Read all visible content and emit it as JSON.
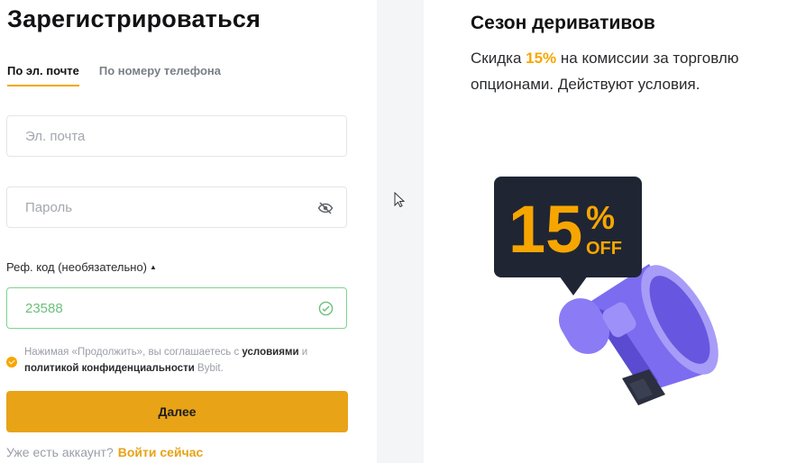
{
  "form": {
    "title": "Зарегистрироваться",
    "tabs": [
      {
        "label": "По эл. почте",
        "active": true
      },
      {
        "label": "По номеру телефона",
        "active": false
      }
    ],
    "email": {
      "placeholder": "Эл. почта",
      "value": ""
    },
    "password": {
      "placeholder": "Пароль",
      "value": ""
    },
    "ref": {
      "label": "Реф. код (необязательно)",
      "arrow": "▲",
      "value": "23588"
    },
    "consent": {
      "prefix": "Нажимая «Продолжить», вы соглашаетесь с",
      "terms_link": "условиями",
      "and": "и",
      "privacy_link": "политикой конфиденциальности",
      "suffix": "Bybit."
    },
    "submit_label": "Далее",
    "login_prompt": "Уже есть аккаунт?",
    "login_link": "Войти сейчас"
  },
  "promo": {
    "title": "Сезон деривативов",
    "text_before": "Скидка",
    "highlight": "15%",
    "text_after": "на комиссии за торговлю опционами. Действуют условия.",
    "badge_number": "15",
    "badge_percent": "%",
    "badge_off": "OFF"
  },
  "colors": {
    "accent": "#f7a600",
    "button": "#e8a317",
    "success": "#7ed48f",
    "badge_bg": "#202534",
    "megaphone": "#7b6cf0"
  }
}
